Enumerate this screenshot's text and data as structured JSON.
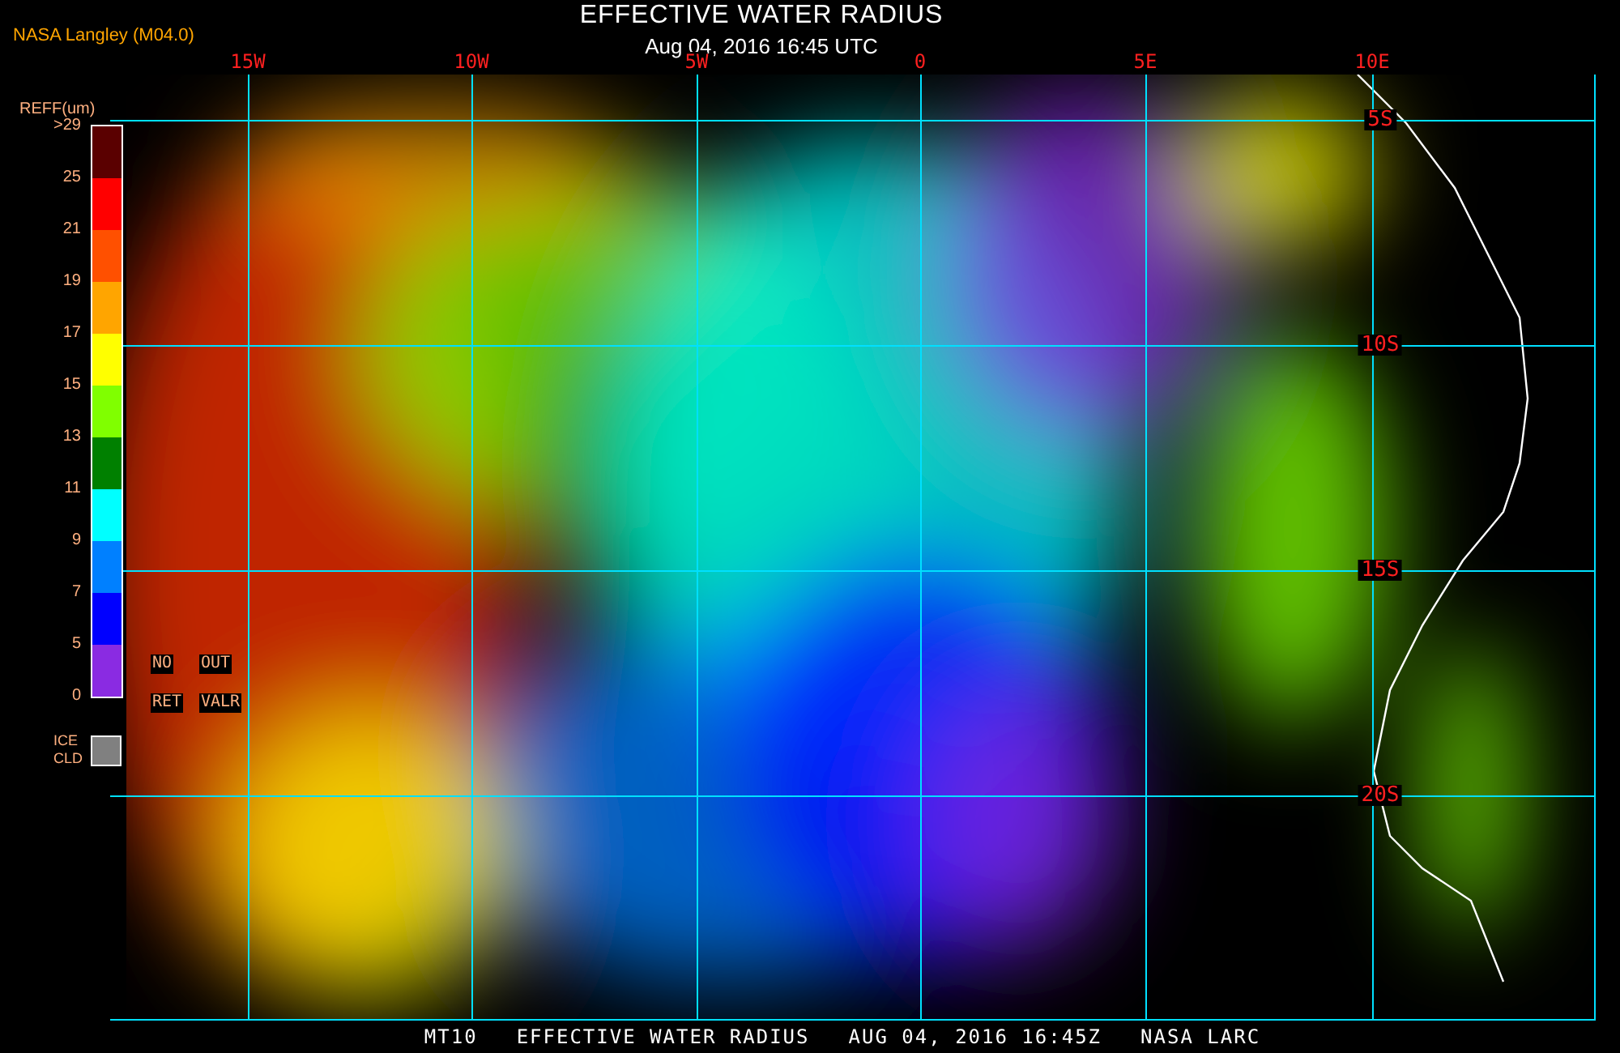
{
  "header": {
    "source": "NASA Langley (M04.0)",
    "title": "EFFECTIVE WATER RADIUS",
    "subtitle": "Aug 04, 2016 16:45 UTC"
  },
  "map": {
    "longitude_labels": [
      "15W",
      "10W",
      "5W",
      "0",
      "5E",
      "10E"
    ],
    "latitude_labels": [
      "5S",
      "10S",
      "15S",
      "20S"
    ]
  },
  "legend": {
    "title": "REFF(um)",
    "ticks": [
      ">29",
      "25",
      "21",
      "19",
      "17",
      "15",
      "13",
      "11",
      "9",
      "7",
      "5",
      "0"
    ],
    "bands": [
      {
        "color": "#5a0000"
      },
      {
        "color": "#ff0000"
      },
      {
        "color": "#ff5000"
      },
      {
        "color": "#ffa500"
      },
      {
        "color": "#ffff00"
      },
      {
        "color": "#80ff00"
      },
      {
        "color": "#008000"
      },
      {
        "color": "#00ffff"
      },
      {
        "color": "#0080ff"
      },
      {
        "color": "#0000ff"
      },
      {
        "color": "#8a2be2"
      }
    ],
    "no_retrieval": [
      "NO",
      "RET"
    ],
    "out_of_range": [
      "OUT",
      "VALR"
    ],
    "ice_cloud": {
      "label": [
        "ICE",
        "CLD"
      ],
      "color": "#808080"
    }
  },
  "footer": [
    "MT10",
    "EFFECTIVE WATER RADIUS",
    "AUG 04, 2016 16:45Z",
    "NASA LARC"
  ]
}
